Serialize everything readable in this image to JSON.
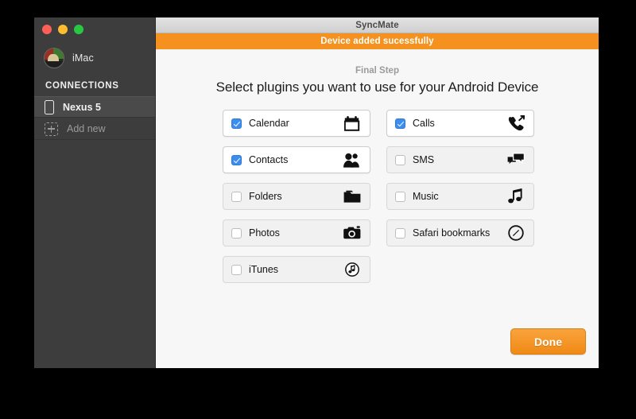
{
  "window": {
    "titlebar_title": "SyncMate",
    "banner_text": "Device added sucessfully",
    "traffic_lights": [
      "close-button",
      "minimize-button",
      "maximize-button"
    ]
  },
  "sidebar": {
    "account": {
      "name": "iMac",
      "avatar_icon": "user-avatar"
    },
    "section_header": "CONNECTIONS",
    "items": [
      {
        "label": "Nexus 5",
        "icon": "phone-icon",
        "selected": true
      },
      {
        "label": "Add new",
        "icon": "plus-icon",
        "selected": false
      }
    ]
  },
  "main": {
    "step_label": "Final Step",
    "headline": "Select plugins you want to use for your Android Device",
    "done_button": "Done",
    "plugins": [
      {
        "label": "Calendar",
        "icon": "calendar-icon",
        "checked": true
      },
      {
        "label": "Calls",
        "icon": "phone-call-icon",
        "checked": true
      },
      {
        "label": "Contacts",
        "icon": "contacts-icon",
        "checked": true
      },
      {
        "label": "SMS",
        "icon": "sms-icon",
        "checked": false
      },
      {
        "label": "Folders",
        "icon": "folder-icon",
        "checked": false
      },
      {
        "label": "Music",
        "icon": "music-note-icon",
        "checked": false
      },
      {
        "label": "Photos",
        "icon": "camera-icon",
        "checked": false
      },
      {
        "label": "Safari bookmarks",
        "icon": "safari-icon",
        "checked": false
      },
      {
        "label": "iTunes",
        "icon": "itunes-icon",
        "checked": false
      }
    ]
  },
  "colors": {
    "accent_orange": "#f5911e",
    "checkbox_blue": "#3b8ef0",
    "sidebar_dark": "#3d3d3d",
    "panel_bg": "#f7f7f7",
    "desktop_bg": "#000000"
  }
}
